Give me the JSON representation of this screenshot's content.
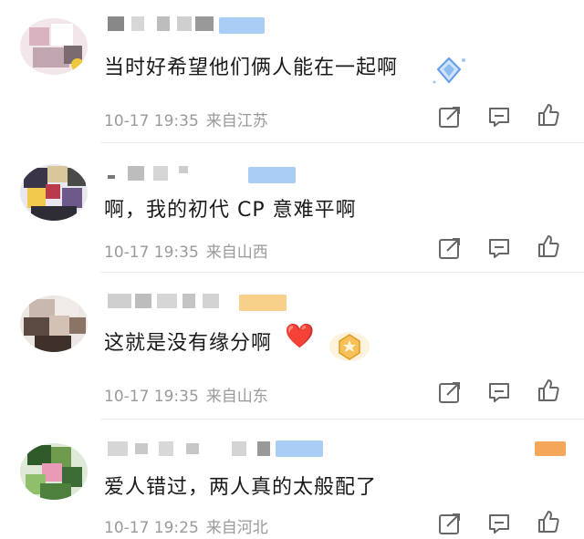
{
  "comments": [
    {
      "text": "当时好希望他们俩人能在一起啊",
      "time": "10-17 19:35",
      "location": "来自江苏",
      "badge_color": "#a9cdf5"
    },
    {
      "text": "啊，我的初代 CP 意难平啊",
      "time": "10-17 19:35",
      "location": "来自山西",
      "badge_color": "#a9cdf5"
    },
    {
      "text": "这就是没有缘分啊",
      "time": "10-17 19:35",
      "location": "来自山东",
      "badge_color": "#f7d08a",
      "emoji": "❤️"
    },
    {
      "text": "爱人错过，两人真的太般配了",
      "time": "10-17 19:25",
      "location": "来自河北",
      "badge_color": "#a9cdf5"
    }
  ],
  "icons": [
    "share-icon",
    "comment-icon",
    "like-icon"
  ]
}
